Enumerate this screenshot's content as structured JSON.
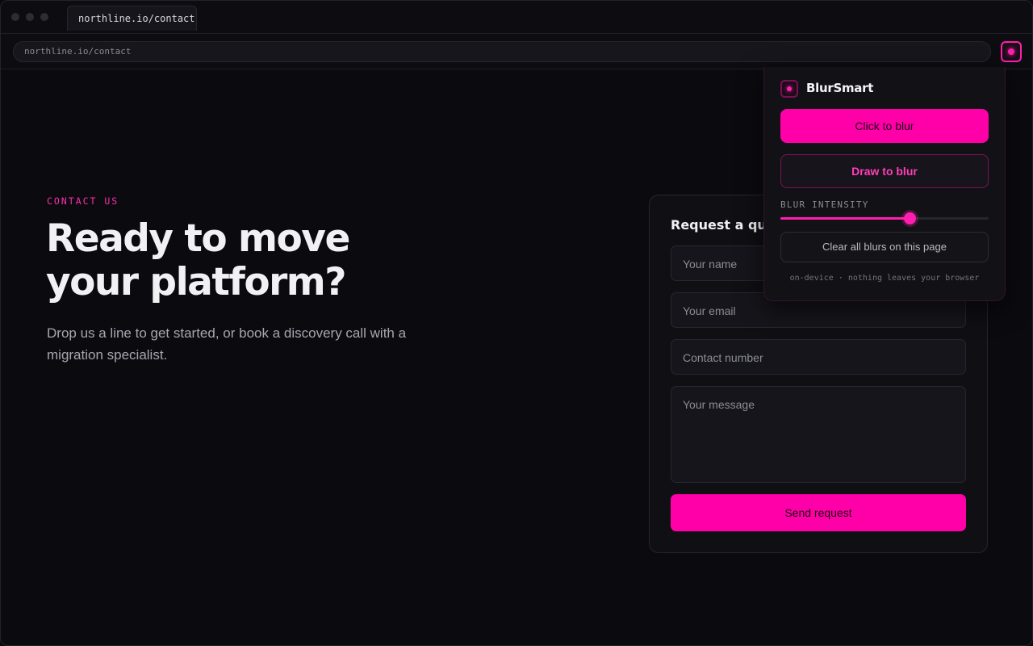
{
  "browser": {
    "tab_title": "northline.io/contact",
    "url": "northline.io/contact"
  },
  "page": {
    "eyebrow": "CONTACT US",
    "headline": "Ready to move your platform?",
    "subtext": "Drop us a line to get started, or book a discovery call with a migration specialist."
  },
  "form": {
    "title": "Request a quote",
    "name_placeholder": "Your name",
    "email_placeholder": "Your email",
    "phone_placeholder": "Contact number",
    "message_placeholder": "Your message",
    "submit_label": "Send request"
  },
  "extension": {
    "name": "BlurSmart",
    "click_label": "Click to blur",
    "draw_label": "Draw to blur",
    "intensity_label": "BLUR INTENSITY",
    "intensity_value": 0.62,
    "clear_label": "Clear all blurs on this page",
    "footnote": "on-device · nothing leaves your browser"
  },
  "colors": {
    "accent": "#ff00a8",
    "background": "#0b0b0f"
  }
}
